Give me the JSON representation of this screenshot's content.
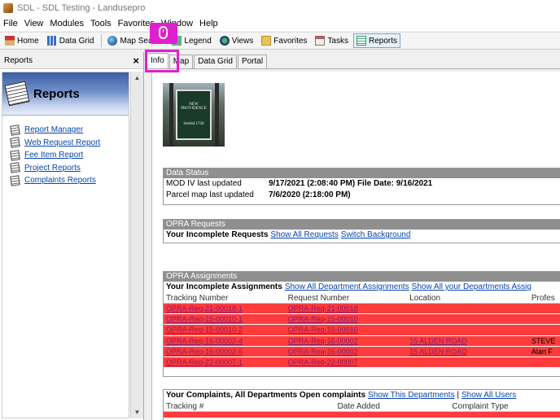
{
  "window": {
    "title": "SDL - SDL Testing - Landusepro"
  },
  "menu": [
    "File",
    "View",
    "Modules",
    "Tools",
    "Favorites",
    "Window",
    "Help"
  ],
  "toolbar": [
    {
      "label": "Home",
      "icon": "home-icon"
    },
    {
      "label": "Data Grid",
      "icon": "grid-icon"
    },
    {
      "label": "Map Search",
      "icon": "globe-icon"
    },
    {
      "label": "Legend",
      "icon": "legend-icon"
    },
    {
      "label": "Views",
      "icon": "views-icon"
    },
    {
      "label": "Favorites",
      "icon": "folder-star-icon"
    },
    {
      "label": "Tasks",
      "icon": "tasks-icon"
    },
    {
      "label": "Reports",
      "icon": "reports-icon"
    }
  ],
  "left_panel": {
    "title": "Reports",
    "close": "×",
    "header": "Reports",
    "links": [
      "Report Manager",
      "Web Request Report",
      "Fee Item Report",
      "Project Reports",
      "Complaints Reports"
    ]
  },
  "tabs": [
    "Info",
    "Map",
    "Data Grid",
    "Portal"
  ],
  "photo": {
    "line1": "NEW PROVIDENCE",
    "line2": "Settled 1720"
  },
  "data_status": {
    "header": "Data Status",
    "rows": [
      {
        "label": "MOD IV last updated",
        "value": "9/17/2021 (2:08:40 PM) File Date: 9/16/2021"
      },
      {
        "label": "Parcel map last updated",
        "value": "7/6/2020 (2:18:00 PM)"
      }
    ]
  },
  "opra_requests": {
    "header": "OPRA Requests",
    "title": "Your Incomplete Requests",
    "link1": "Show All Requests",
    "link2": "Switch Background"
  },
  "opra_assignments": {
    "header": "OPRA Assignments",
    "title": "Your Incomplete Assignments",
    "link1": "Show All Department Assignments",
    "link2": "Show All your Departments Assig",
    "columns": [
      "Tracking Number",
      "Request Number",
      "Location",
      "Profes"
    ],
    "rows": [
      [
        "OPRA-Req-21-00018-1",
        "OPRA-Req-21-00018",
        "",
        ""
      ],
      [
        "OPRA-Req-15-00010-1",
        "OPRA-Req-15-00010",
        "",
        ""
      ],
      [
        "OPRA-Req-15-00010-2",
        "OPRA-Req-15-00010",
        "",
        ""
      ],
      [
        "OPRA-Req-16-00002-4",
        "OPRA-Req-16-00002",
        "15 ALDEN ROAD",
        "STEVE"
      ],
      [
        "OPRA-Req-16-00002-6",
        "OPRA-Req-16-00002",
        "15 ALDEN ROAD",
        "Alan F"
      ],
      [
        "OPRA-Req-22-00007-1",
        "OPRA-Req-22-00007",
        "",
        ""
      ]
    ]
  },
  "complaints": {
    "title": "Your Complaints, All Departments Open complaints",
    "link1": "Show This Departments",
    "divider": "|",
    "link2": "Show All Users",
    "columns": [
      "Tracking #",
      "Date Added",
      "Complaint Type"
    ]
  }
}
